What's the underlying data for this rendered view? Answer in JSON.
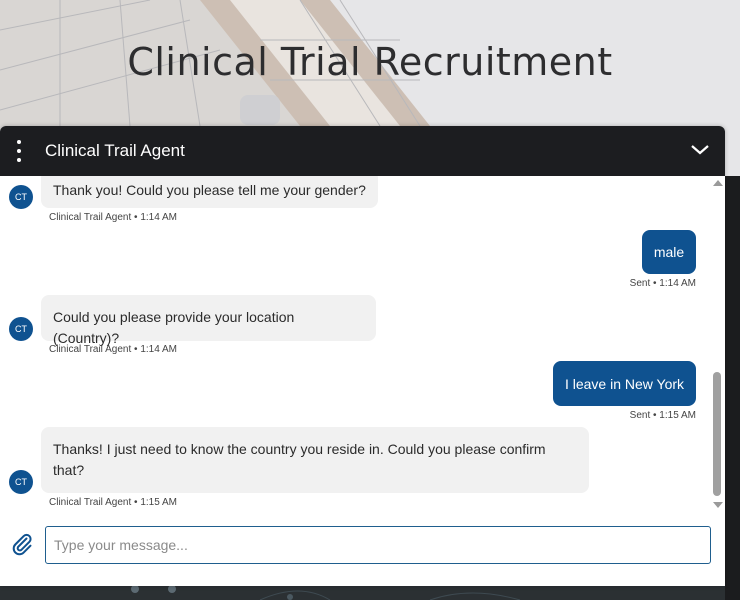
{
  "page": {
    "title": "Clinical Trial Recruitment"
  },
  "chat": {
    "header_title": "Clinical Trail Agent",
    "messages": [
      {
        "sender": "agent",
        "avatar": "CT",
        "text": "Thank you! Could you please tell me your gender?",
        "meta": "Clinical Trail Agent • 1:14 AM"
      },
      {
        "sender": "user",
        "text": "male",
        "meta": "Sent • 1:14 AM"
      },
      {
        "sender": "agent",
        "avatar": "CT",
        "text": "Could you please provide your location (Country)?",
        "meta": "Clinical Trail Agent • 1:14 AM"
      },
      {
        "sender": "user",
        "text": "I leave in New York",
        "meta": "Sent • 1:15 AM"
      },
      {
        "sender": "agent",
        "avatar": "CT",
        "text": "Thanks! I just need to know the country you reside in. Could you please confirm that?",
        "meta": "Clinical Trail Agent • 1:15 AM"
      }
    ],
    "input_placeholder": "Type your message...",
    "input_value": ""
  },
  "icons": {
    "menu": "kebab-menu-icon",
    "collapse": "chevron-down-icon",
    "attach": "paperclip-icon"
  },
  "colors": {
    "header_bg": "#1c1d20",
    "user_bubble": "#0f5290",
    "agent_bubble": "#f1f1f1",
    "avatar": "#0f5290"
  }
}
